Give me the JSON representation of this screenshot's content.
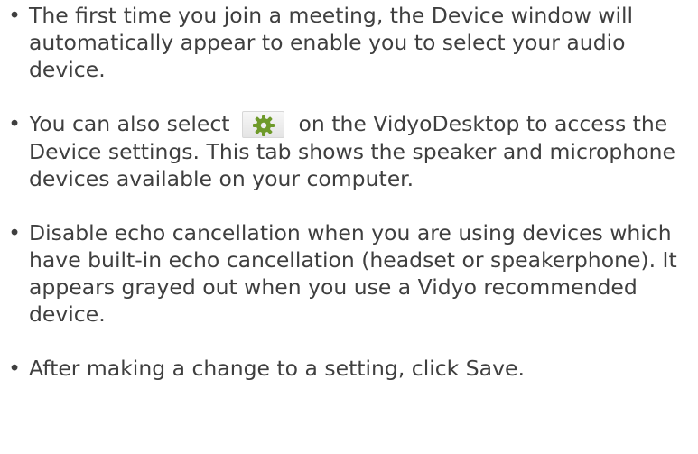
{
  "bullets": [
    {
      "text": "The first time you join a meeting, the Device window will automatically appear to enable you to select your audio device."
    },
    {
      "text_before": "You can also select",
      "icon": "gear-icon",
      "text_after": "on the VidyoDesktop to access the Device settings. This tab shows the speaker and microphone devices available on your computer."
    },
    {
      "text": "Disable echo cancellation when you are using devices which have built-in echo cancellation (headset or speakerphone). It appears grayed out when you use a Vidyo recommended device."
    },
    {
      "text": "After making a change to a setting, click Save."
    }
  ],
  "colors": {
    "text": "#3f3f3f",
    "gear_icon": "#6e9a2a"
  }
}
